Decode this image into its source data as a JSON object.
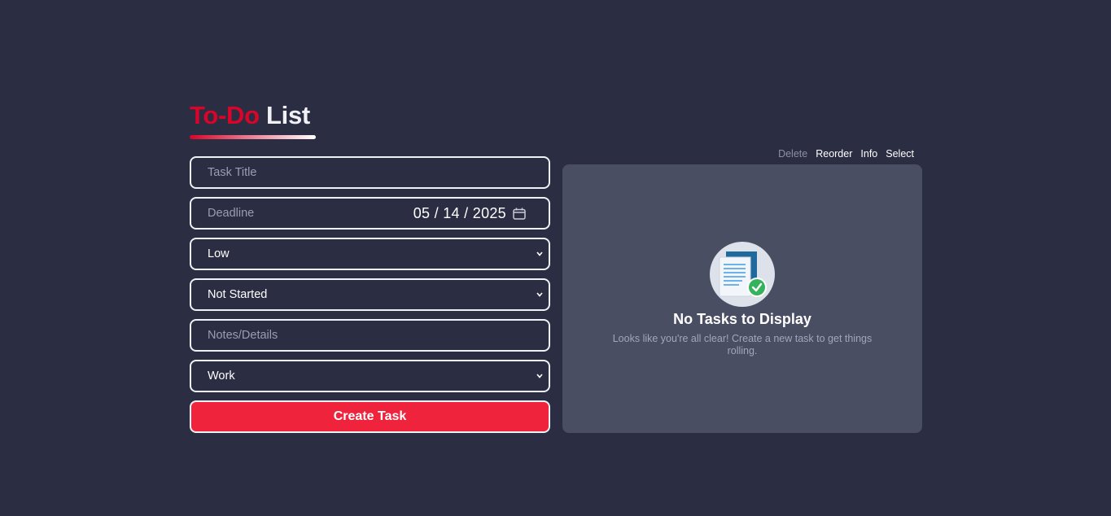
{
  "header": {
    "title_accent": "To-Do",
    "title_rest": "List"
  },
  "form": {
    "task_title_placeholder": "Task Title",
    "deadline_placeholder": "Deadline",
    "deadline_value": "05 / 14 / 2025",
    "priority_value": "Low",
    "status_value": "Not Started",
    "notes_placeholder": "Notes/Details",
    "category_value": "Work",
    "create_label": "Create Task"
  },
  "toolbar": {
    "delete_label": "Delete",
    "reorder_label": "Reorder",
    "info_label": "Info",
    "select_label": "Select"
  },
  "empty_state": {
    "title": "No Tasks to Display",
    "subtitle": "Looks like you're all clear! Create a new task to get things rolling."
  },
  "colors": {
    "background": "#2b2d42",
    "accent": "#d90429",
    "button": "#ef233c",
    "panel": "#4a4e63",
    "border": "#edf2f4"
  }
}
